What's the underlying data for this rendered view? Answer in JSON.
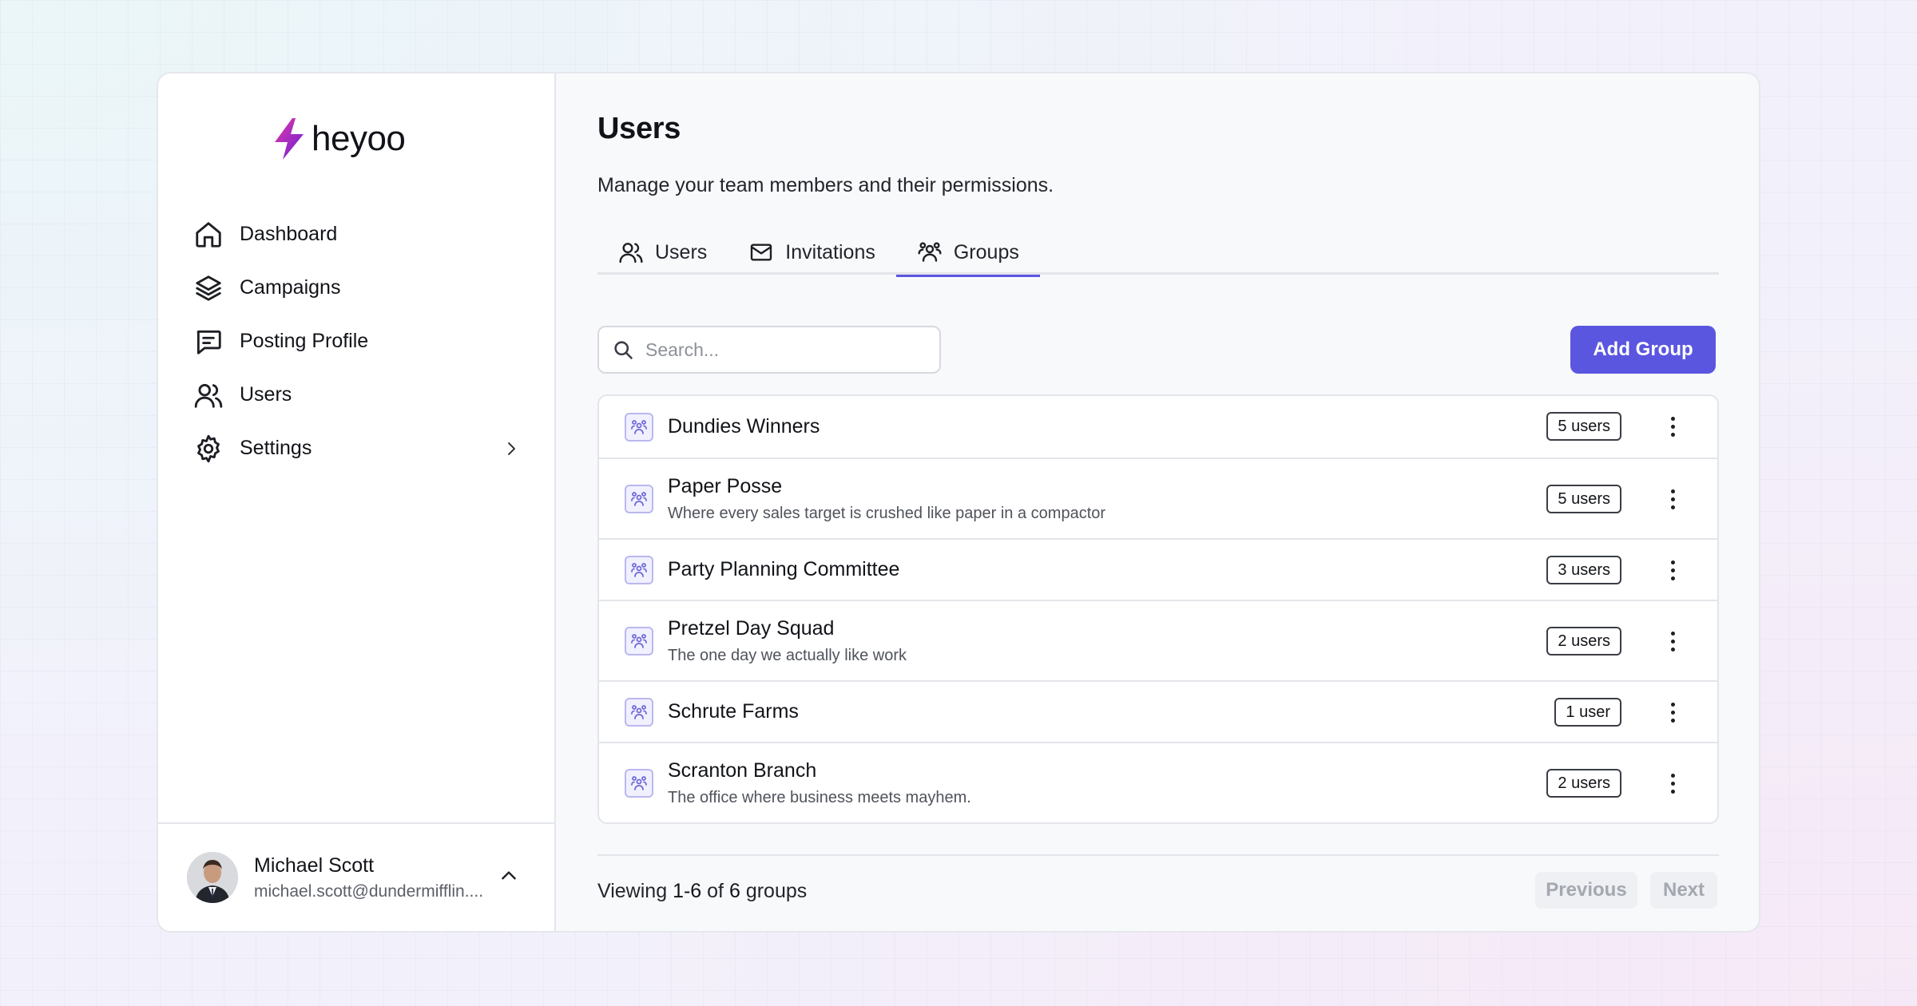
{
  "app": {
    "name": "heyoo",
    "accent": "#5b56e0",
    "brand_gradient": [
      "#e03aa8",
      "#6d1fd6"
    ]
  },
  "sidebar": {
    "items": [
      {
        "label": "Dashboard",
        "icon": "home-icon"
      },
      {
        "label": "Campaigns",
        "icon": "layers-icon"
      },
      {
        "label": "Posting Profile",
        "icon": "message-square-icon"
      },
      {
        "label": "Users",
        "icon": "users-icon"
      },
      {
        "label": "Settings",
        "icon": "gear-icon",
        "has_submenu": true
      }
    ],
    "user": {
      "name": "Michael Scott",
      "email": "michael.scott@dundermifflin...."
    }
  },
  "main": {
    "title": "Users",
    "subtitle": "Manage your team members and their permissions.",
    "tabs": [
      {
        "label": "Users",
        "icon": "users-icon",
        "active": false
      },
      {
        "label": "Invitations",
        "icon": "mail-icon",
        "active": false
      },
      {
        "label": "Groups",
        "icon": "group-icon",
        "active": true
      }
    ],
    "search": {
      "placeholder": "Search...",
      "value": ""
    },
    "add_button": "Add Group",
    "groups": [
      {
        "name": "Dundies Winners",
        "description": "",
        "count": "5 users"
      },
      {
        "name": "Paper Posse",
        "description": "Where every sales target is crushed like paper in a compactor",
        "count": "5 users"
      },
      {
        "name": "Party Planning Committee",
        "description": "",
        "count": "3 users"
      },
      {
        "name": "Pretzel Day Squad",
        "description": "The one day we actually like work",
        "count": "2 users"
      },
      {
        "name": "Schrute Farms",
        "description": "",
        "count": "1 user"
      },
      {
        "name": "Scranton Branch",
        "description": "The office where business meets mayhem.",
        "count": "2 users"
      }
    ],
    "pagination": {
      "prefix": "Viewing",
      "range": "1-6",
      "of": "of",
      "total": "6",
      "suffix": "groups",
      "previous": "Previous",
      "next": "Next"
    }
  }
}
